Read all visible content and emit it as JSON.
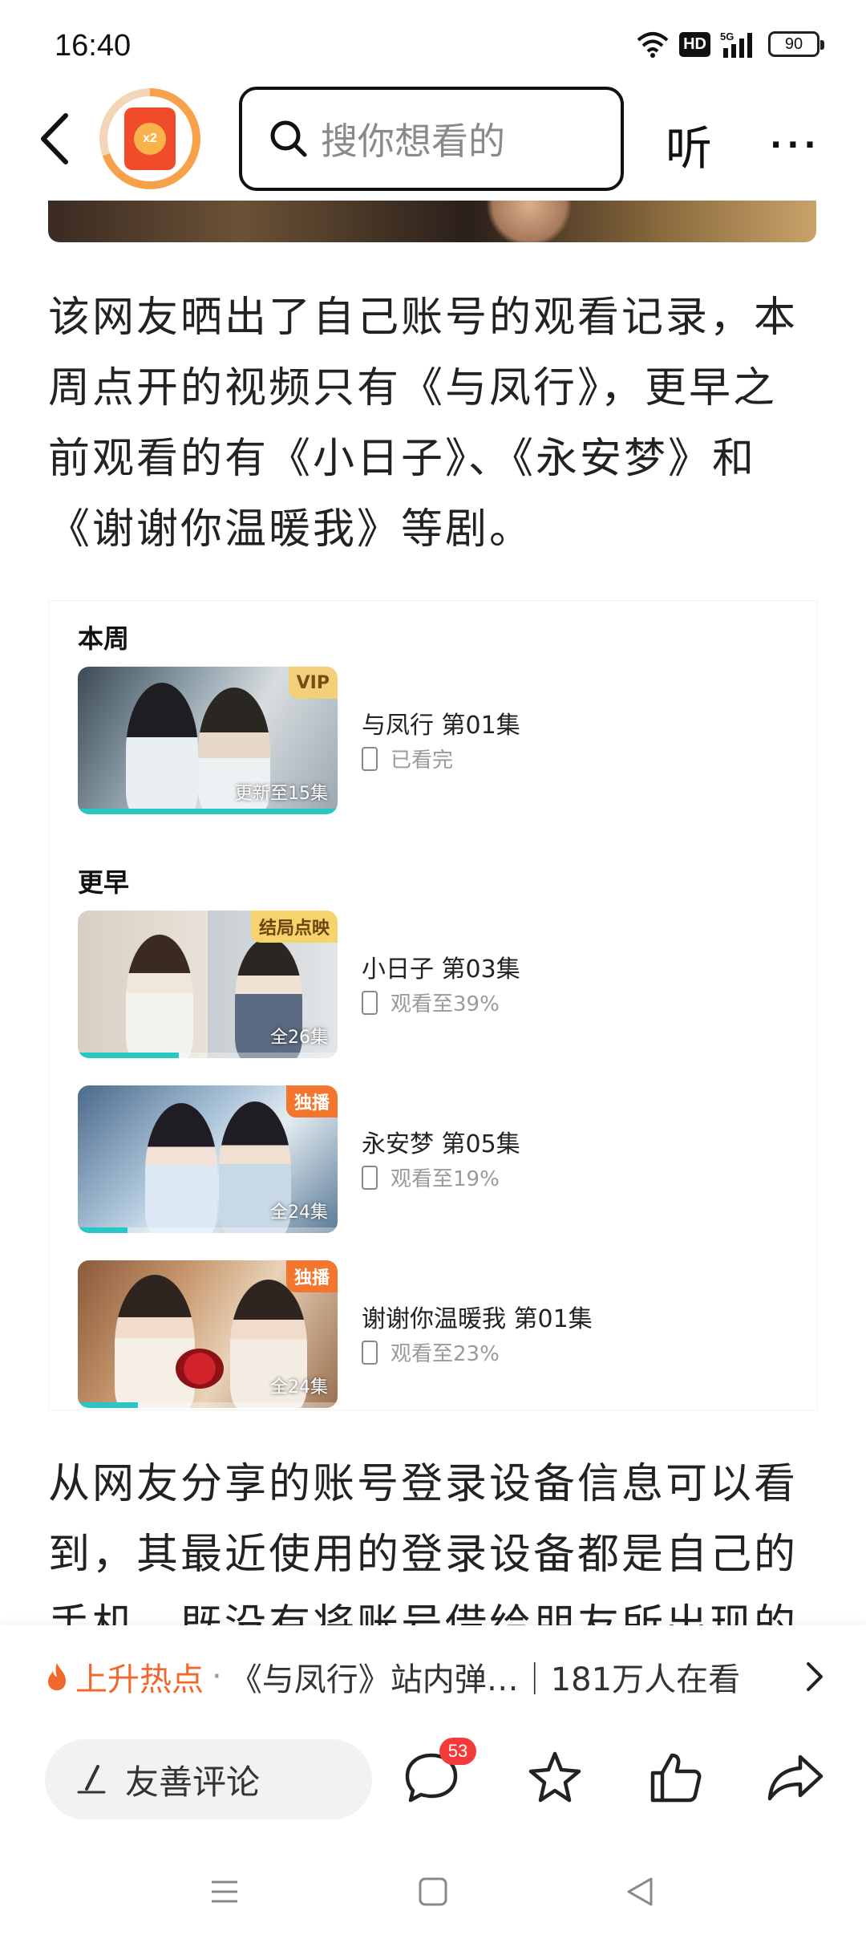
{
  "status_bar": {
    "time": "16:40",
    "icons": [
      "wifi-icon",
      "hd-icon",
      "signal-5g-icon",
      "battery-icon"
    ],
    "hd_label": "HD",
    "network_label": "5G",
    "battery_level": "90"
  },
  "nav": {
    "back_icon": "chevron-left-icon",
    "reward_badge": "x2",
    "search_placeholder": "搜你想看的",
    "listen_label": "听",
    "more_label": "···"
  },
  "article": {
    "paragraph_1": "该网友晒出了自己账号的观看记录，本周点开的视频只有《与凤行》，更早之前观看的有《小日子》、《永安梦》和《谢谢你温暖我》等剧。",
    "paragraph_2": "从网友分享的账号登录设备信息可以看到，其最近使用的登录设备都是自己的手机，既没有将账号借给朋友所出现的其他"
  },
  "history": {
    "sections": [
      {
        "label": "本周",
        "items": [
          {
            "title": "与凤行 第01集",
            "status": "已看完",
            "badge": "VIP",
            "badge_type": "vip",
            "count": "更新至15集",
            "progress": 1.0
          }
        ]
      },
      {
        "label": "更早",
        "items": [
          {
            "title": "小日子 第03集",
            "status": "观看至39%",
            "badge": "结局点映",
            "badge_type": "ending",
            "count": "全26集",
            "progress": 0.39
          },
          {
            "title": "永安梦 第05集",
            "status": "观看至19%",
            "badge": "独播",
            "badge_type": "exclusive",
            "count": "全24集",
            "progress": 0.19
          },
          {
            "title": "谢谢你温暖我 第01集",
            "status": "观看至23%",
            "badge": "独播",
            "badge_type": "exclusive",
            "count": "全24集",
            "progress": 0.23
          }
        ]
      }
    ]
  },
  "hot_bar": {
    "label": "上升热点",
    "separator": "·",
    "text": "《与凤行》站内弹…｜181万人在看"
  },
  "action_bar": {
    "comment_placeholder": "友善评论",
    "comment_count": "53"
  },
  "colors": {
    "accent_orange": "#f0682b",
    "progress_teal": "#28c7c4",
    "badge_red": "#f43a3a"
  }
}
